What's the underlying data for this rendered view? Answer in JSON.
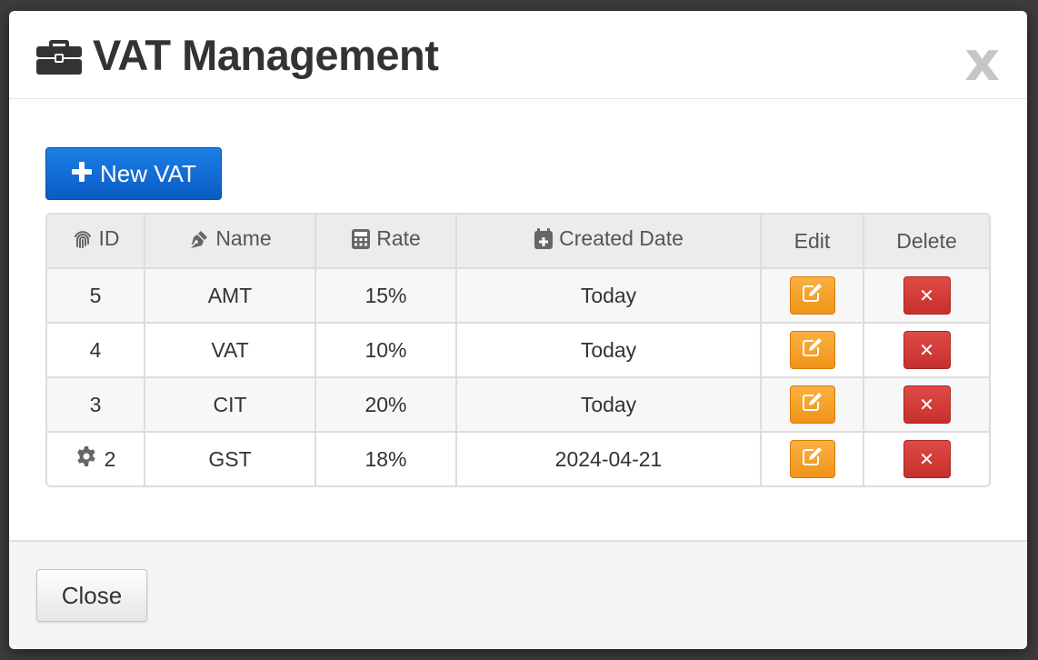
{
  "modal": {
    "title": "VAT Management",
    "title_icon": "briefcase-icon",
    "close_glyph": "x"
  },
  "toolbar": {
    "new_label": "New VAT",
    "new_icon": "plus-icon"
  },
  "table": {
    "headers": {
      "id": "ID",
      "name": "Name",
      "rate": "Rate",
      "created": "Created Date",
      "edit": "Edit",
      "delete": "Delete"
    },
    "header_icons": {
      "id": "fingerprint-icon",
      "name": "pen-nib-icon",
      "rate": "calculator-icon",
      "created": "calendar-plus-icon"
    },
    "rows": [
      {
        "id": "5",
        "name": "AMT",
        "rate": "15%",
        "created": "Today",
        "has_gear": false
      },
      {
        "id": "4",
        "name": "VAT",
        "rate": "10%",
        "created": "Today",
        "has_gear": false
      },
      {
        "id": "3",
        "name": "CIT",
        "rate": "20%",
        "created": "Today",
        "has_gear": false
      },
      {
        "id": "2",
        "name": "GST",
        "rate": "18%",
        "created": "2024-04-21",
        "has_gear": true
      }
    ],
    "delete_glyph": "✕"
  },
  "footer": {
    "close_label": "Close"
  },
  "colors": {
    "primary": "#0a5cc4",
    "warning": "#f09419",
    "danger": "#c7302c"
  }
}
